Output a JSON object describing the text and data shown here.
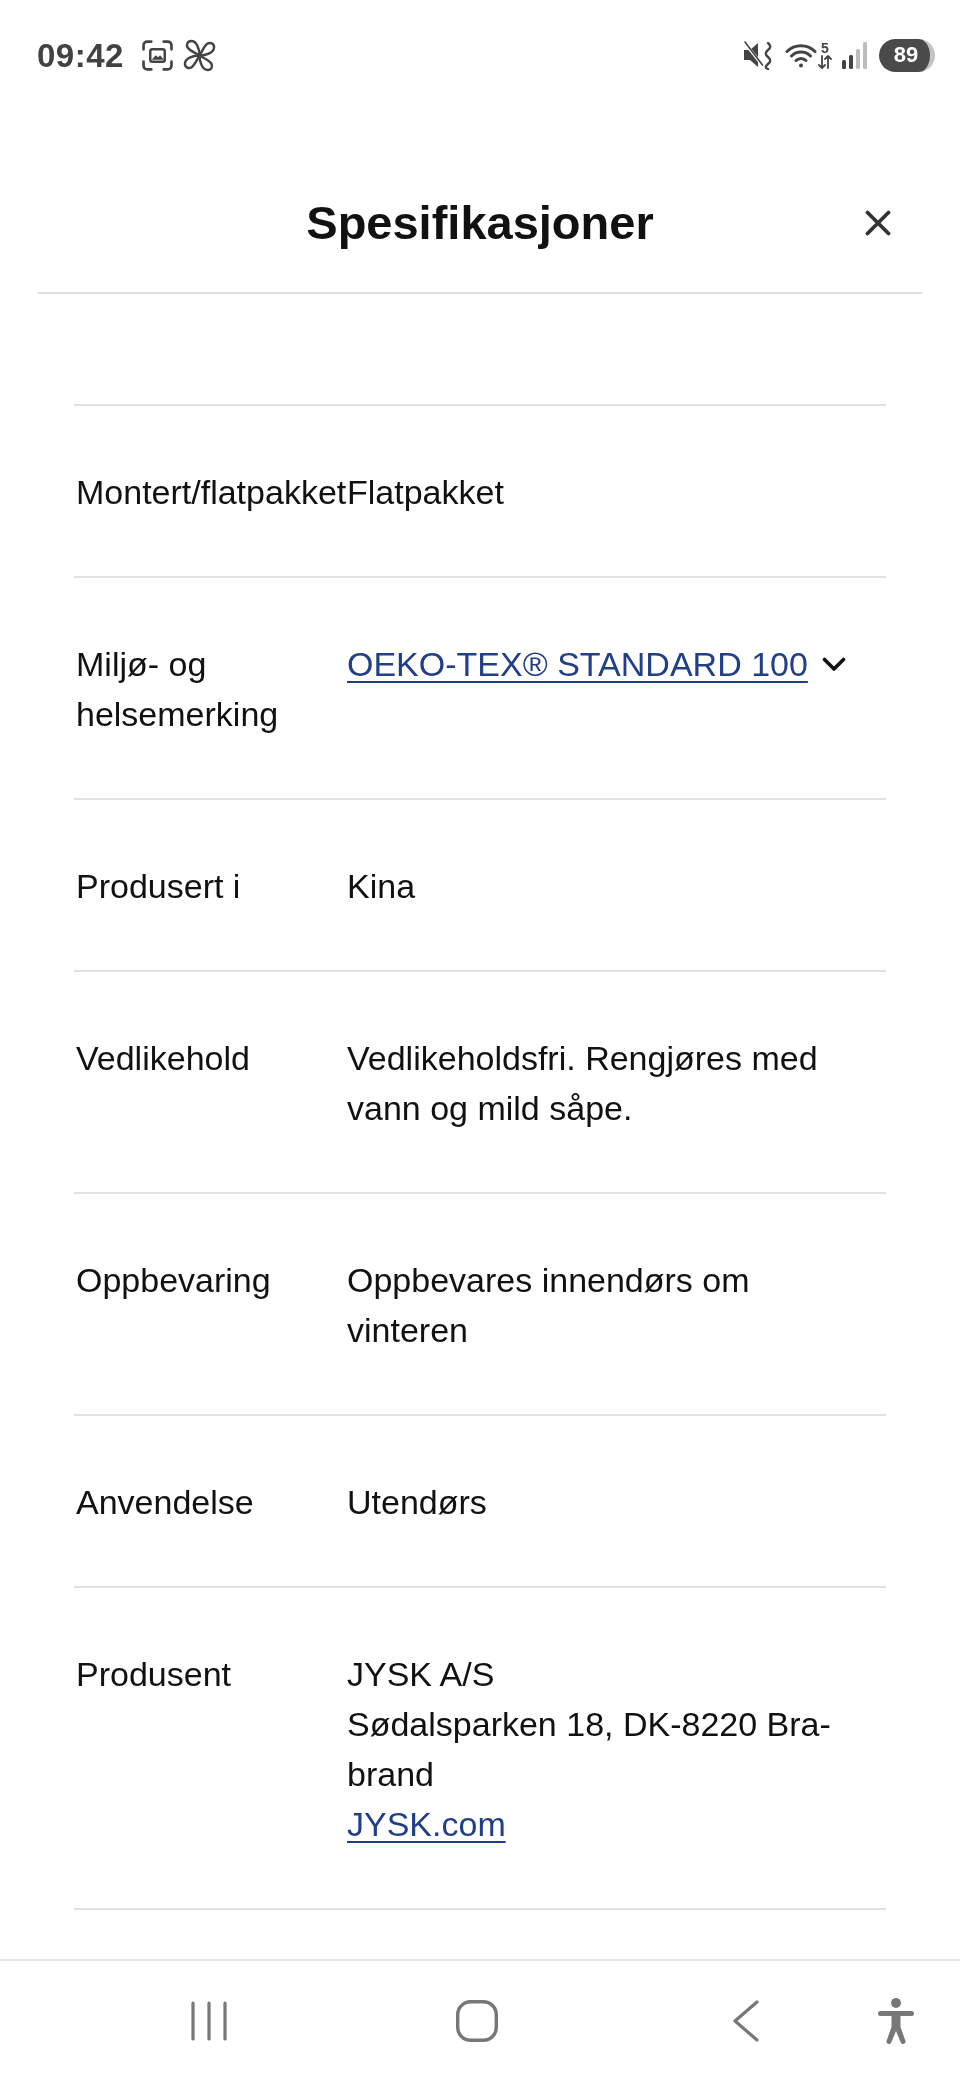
{
  "status_bar": {
    "time": "09:42",
    "wifi_label": "5",
    "battery": "89"
  },
  "header": {
    "title": "Spesifikasjoner"
  },
  "specs": [
    {
      "label": "Montert/flatpakket",
      "values": [
        {
          "kind": "text",
          "text": "Flatpakket"
        }
      ]
    },
    {
      "label": "Miljø- og helsemerking",
      "values": [
        {
          "kind": "dropdown_link",
          "text": "OEKO-TEX® STANDARD 100",
          "expanded": false
        }
      ]
    },
    {
      "label": "Produsert i",
      "values": [
        {
          "kind": "text",
          "text": "Kina"
        }
      ]
    },
    {
      "label": "Vedlikehold",
      "values": [
        {
          "kind": "text",
          "text": "Vedlikeholdsfri. Rengjøres med vann og mild såpe."
        }
      ]
    },
    {
      "label": "Oppbevaring",
      "values": [
        {
          "kind": "text",
          "text": "Oppbevares innendørs om vinteren"
        }
      ]
    },
    {
      "label": "Anvendelse",
      "values": [
        {
          "kind": "text",
          "text": "Utendørs"
        }
      ]
    },
    {
      "label": "Produsent",
      "values": [
        {
          "kind": "text",
          "text": "JYSK A/S"
        },
        {
          "kind": "text",
          "text": "Sødalsparken 18, DK-8220 Bra-brand"
        },
        {
          "kind": "link",
          "text": "JYSK.com"
        }
      ]
    }
  ]
}
